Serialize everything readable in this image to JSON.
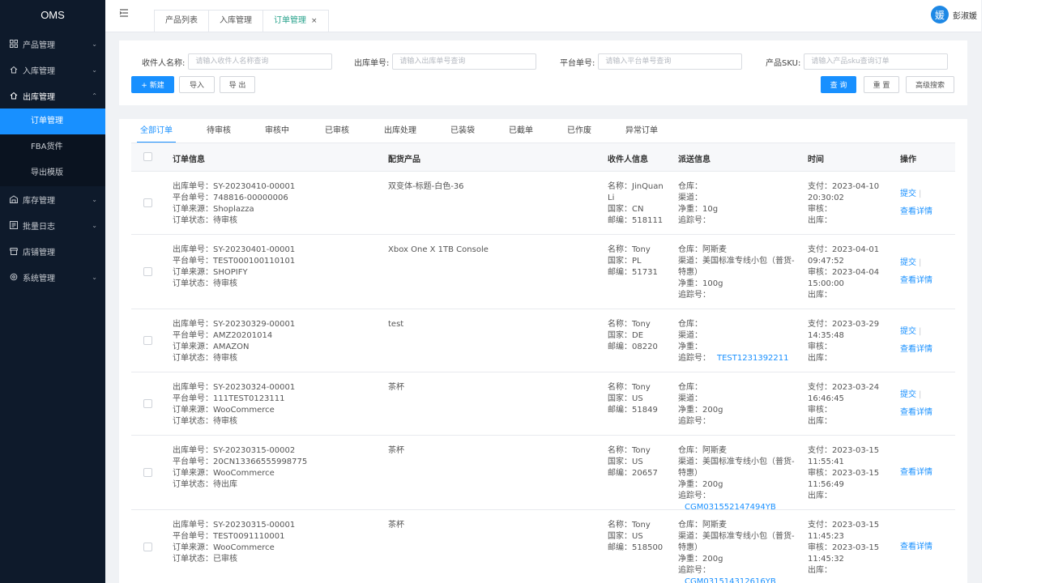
{
  "app": {
    "logo": "OMS"
  },
  "sidebar": {
    "items": [
      {
        "label": "产品管理",
        "icon": "grid-icon"
      },
      {
        "label": "入库管理",
        "icon": "inbound-icon"
      },
      {
        "label": "出库管理",
        "icon": "outbound-icon",
        "children": [
          {
            "label": "订单管理",
            "active": true
          },
          {
            "label": "FBA货件"
          },
          {
            "label": "导出模版"
          }
        ]
      },
      {
        "label": "库存管理",
        "icon": "warehouse-icon"
      },
      {
        "label": "批量日志",
        "icon": "log-icon"
      },
      {
        "label": "店铺管理",
        "icon": "shop-icon"
      },
      {
        "label": "系统管理",
        "icon": "settings-icon"
      }
    ]
  },
  "header": {
    "tabs": [
      {
        "label": "产品列表"
      },
      {
        "label": "入库管理"
      },
      {
        "label": "订单管理",
        "active": true,
        "close": "×"
      }
    ],
    "user": {
      "avatar_char": "媛",
      "name": "彭淑媛"
    }
  },
  "filters": {
    "receiver_label": "收件人名称:",
    "receiver_placeholder": "请输入收件人名称查询",
    "outbound_label": "出库单号:",
    "outbound_placeholder": "请输入出库单号查询",
    "platform_label": "平台单号:",
    "platform_placeholder": "请输入平台单号查询",
    "sku_label": "产品SKU:",
    "sku_placeholder": "请输入产品sku查询订单",
    "new_btn": "+ 新建",
    "import_btn": "导入",
    "export_btn": "导 出",
    "query_btn": "查 询",
    "reset_btn": "重 置",
    "advanced_btn": "高级搜索"
  },
  "status_tabs": [
    "全部订单",
    "待审核",
    "审核中",
    "已审核",
    "出库处理",
    "已装袋",
    "已截单",
    "已作废",
    "异常订单"
  ],
  "table": {
    "headers": {
      "order": "订单信息",
      "product": "配货产品",
      "receiver": "收件人信息",
      "shipping": "派送信息",
      "time": "时间",
      "ops": "操作"
    },
    "rows": [
      {
        "order": [
          "出库单号：SY-20230410-00001",
          "平台单号：748816-00000006",
          "订单来源：Shoplazza",
          "订单状态：待审核"
        ],
        "product": "双变体-标题-白色-36",
        "receiver": [
          "名称：JinQuan Li",
          "国家：CN",
          "邮编：518111"
        ],
        "shipping": [
          "仓库：",
          "渠道：",
          "净重：10g",
          "追踪号："
        ],
        "tracking": "",
        "time": [
          "支付：2023-04-10 20:30:02",
          "审核：",
          "出库："
        ],
        "ops": [
          "提交",
          "查看详情"
        ]
      },
      {
        "order": [
          "出库单号：SY-20230401-00001",
          "平台单号：TEST000100110101",
          "订单来源：SHOPIFY",
          "订单状态：待审核"
        ],
        "product": "Xbox One X 1TB Console",
        "receiver": [
          "名称：Tony",
          "国家：PL",
          "邮编：51731"
        ],
        "shipping": [
          "仓库：阿斯麦",
          "渠道：美国标准专线小包（普货-特惠）",
          "净重：100g",
          "追踪号："
        ],
        "tracking": "",
        "time": [
          "支付：2023-04-01 09:47:52",
          "审核：2023-04-04 15:00:00",
          "出库："
        ],
        "ops": [
          "提交",
          "查看详情"
        ]
      },
      {
        "order": [
          "出库单号：SY-20230329-00001",
          "平台单号：AMZ20201014",
          "订单来源：AMAZON",
          "订单状态：待审核"
        ],
        "product": "test",
        "receiver": [
          "名称：Tony",
          "国家：DE",
          "邮编：08220"
        ],
        "shipping": [
          "仓库：",
          "渠道：",
          "净重：",
          "追踪号："
        ],
        "tracking": "TEST1231392211",
        "time": [
          "支付：2023-03-29 14:35:48",
          "审核：",
          "出库："
        ],
        "ops": [
          "提交",
          "查看详情"
        ]
      },
      {
        "order": [
          "出库单号：SY-20230324-00001",
          "平台单号：111TEST0123111",
          "订单来源：WooCommerce",
          "订单状态：待审核"
        ],
        "product": "茶杯",
        "receiver": [
          "名称：Tony",
          "国家：US",
          "邮编：51849"
        ],
        "shipping": [
          "仓库：",
          "渠道：",
          "净重：200g",
          "追踪号："
        ],
        "tracking": "",
        "time": [
          "支付：2023-03-24 16:46:45",
          "审核：",
          "出库："
        ],
        "ops": [
          "提交",
          "查看详情"
        ]
      },
      {
        "order": [
          "出库单号：SY-20230315-00002",
          "平台单号：20CN13366555998775",
          "订单来源：WooCommerce",
          "订单状态：待出库"
        ],
        "product": "茶杯",
        "receiver": [
          "名称：Tony",
          "国家：US",
          "邮编：20657"
        ],
        "shipping": [
          "仓库：阿斯麦",
          "渠道：美国标准专线小包（普货-特惠）",
          "净重：200g",
          "追踪号："
        ],
        "tracking": "CGM031552147494YB",
        "time": [
          "支付：2023-03-15 11:55:41",
          "审核：2023-03-15 11:56:49",
          "出库："
        ],
        "ops": [
          "查看详情"
        ]
      },
      {
        "order": [
          "出库单号：SY-20230315-00001",
          "平台单号：TEST0091110001",
          "订单来源：WooCommerce",
          "订单状态：已审核"
        ],
        "product": "茶杯",
        "receiver": [
          "名称：Tony",
          "国家：US",
          "邮编：518500"
        ],
        "shipping": [
          "仓库：阿斯麦",
          "渠道：美国标准专线小包（普货-特惠）",
          "净重：200g",
          "追踪号："
        ],
        "tracking": "CGM031514312616YB",
        "time": [
          "支付：2023-03-15 11:45:23",
          "审核：2023-03-15 11:45:32",
          "出库："
        ],
        "ops": [
          "查看详情"
        ]
      }
    ]
  }
}
